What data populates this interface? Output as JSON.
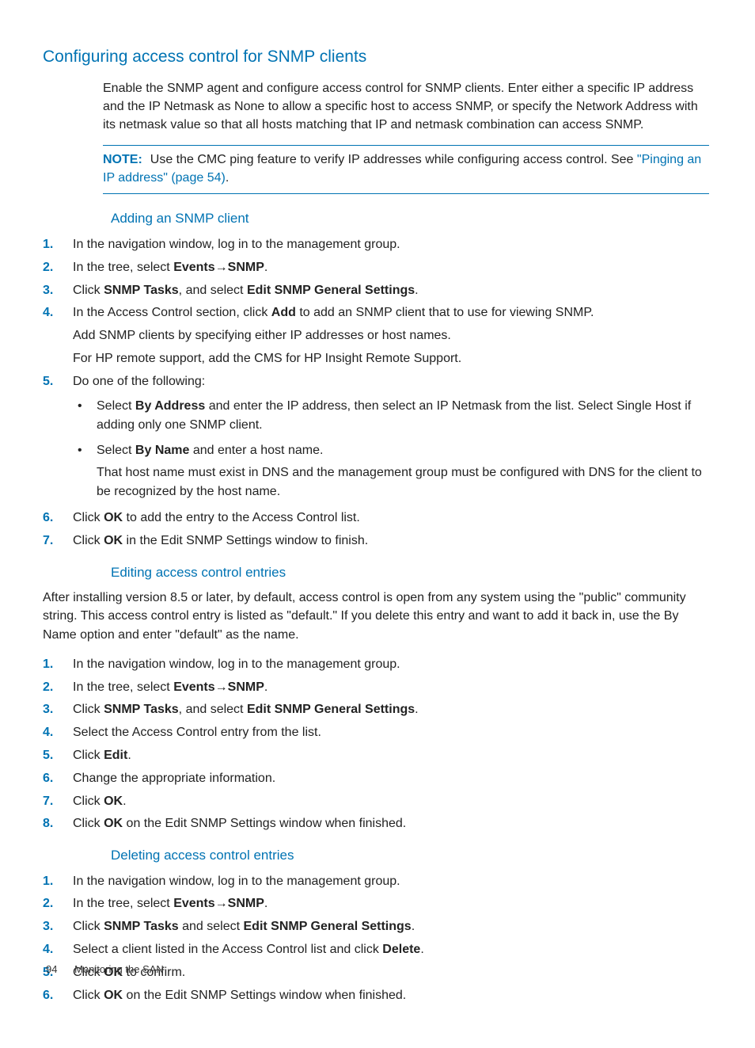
{
  "h1": "Configuring access control for SNMP clients",
  "intro": "Enable the SNMP agent and configure access control for SNMP clients. Enter either a specific IP address and the IP Netmask as None to allow a specific host to access SNMP, or specify the Network Address with its netmask value so that all hosts matching that IP and netmask combination can access SNMP.",
  "note": {
    "label": "NOTE:",
    "text_before_link": "Use the CMC ping feature to verify IP addresses while configuring access control. See ",
    "link": "\"Pinging an IP address\" (page 54)",
    "after": "."
  },
  "adding": {
    "title": "Adding an SNMP client",
    "step1": "In the navigation window, log in to the management group.",
    "step2_pre": "In the tree, select ",
    "events": "Events",
    "arrow": "→",
    "snmp": "SNMP",
    "step3_pre": "Click ",
    "snmp_tasks": "SNMP Tasks",
    "step3_mid": ", and select ",
    "edit_general": "Edit SNMP General Settings",
    "step4_pre": "In the Access Control section, click ",
    "add": "Add",
    "step4_post": " to add an SNMP client that to use for viewing SNMP.",
    "step4_p2": "Add SNMP clients by specifying either IP addresses or host names.",
    "step4_p3": "For HP remote support, add the CMS for HP Insight Remote Support.",
    "step5": "Do one of the following:",
    "bullet1_pre": "Select ",
    "by_address": "By Address",
    "bullet1_post": " and enter the IP address, then select an IP Netmask from the list. Select Single Host if adding only one SNMP client.",
    "bullet2_pre": "Select ",
    "by_name": "By Name",
    "bullet2_post": " and enter a host name.",
    "bullet2_p2": "That host name must exist in DNS and the management group must be configured with DNS for the client to be recognized by the host name.",
    "step6_pre": "Click ",
    "ok": "OK",
    "step6_post": " to add the entry to the Access Control list.",
    "step7_pre": "Click ",
    "step7_post": " in the Edit SNMP Settings window to finish."
  },
  "editing": {
    "title": "Editing access control entries",
    "intro": "After installing version 8.5 or later, by default, access control is open from any system using the \"public\" community string. This access control entry is listed as \"default.\" If you delete this entry and want to add it back in, use the By Name option and enter \"default\" as the name.",
    "step4": "Select the Access Control entry from the list.",
    "step5_pre": "Click ",
    "edit": "Edit",
    "step6": "Change the appropriate information.",
    "step8_pre": "Click ",
    "step8_post": " on the Edit SNMP Settings window when finished."
  },
  "deleting": {
    "title": "Deleting access control entries",
    "step3_mid": " and select ",
    "step4_pre": "Select a client listed in the Access Control list and click ",
    "delete": "Delete",
    "step5_post": " to confirm."
  },
  "footer": {
    "page": "94",
    "title": "Monitoring the SAN"
  }
}
